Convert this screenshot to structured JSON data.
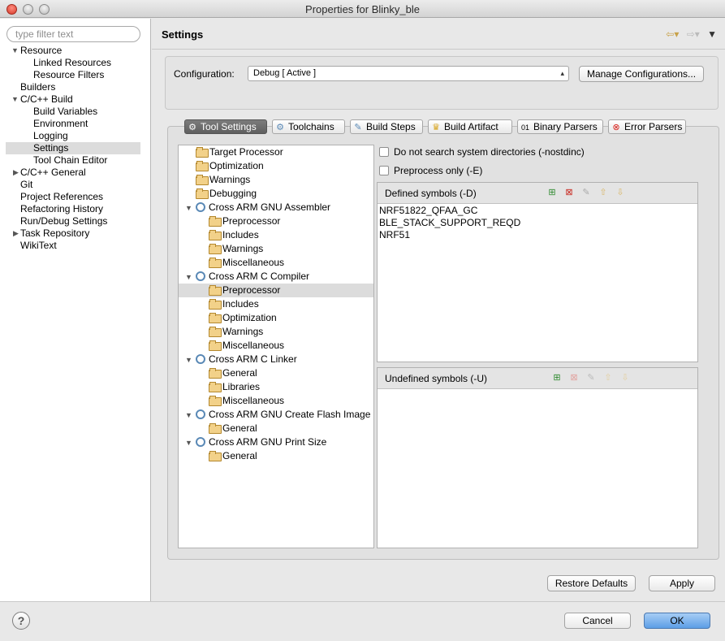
{
  "window": {
    "title": "Properties for Blinky_ble"
  },
  "filter": {
    "placeholder": "type filter text"
  },
  "nav": {
    "items": [
      {
        "label": "Resource",
        "expanded": true
      },
      {
        "label": "Linked Resources"
      },
      {
        "label": "Resource Filters"
      },
      {
        "label": "Builders"
      },
      {
        "label": "C/C++ Build",
        "expanded": true
      },
      {
        "label": "Build Variables"
      },
      {
        "label": "Environment"
      },
      {
        "label": "Logging"
      },
      {
        "label": "Settings",
        "selected": true
      },
      {
        "label": "Tool Chain Editor"
      },
      {
        "label": "C/C++ General",
        "expanded": false
      },
      {
        "label": "Git"
      },
      {
        "label": "Project References"
      },
      {
        "label": "Refactoring History"
      },
      {
        "label": "Run/Debug Settings"
      },
      {
        "label": "Task Repository",
        "expanded": false
      },
      {
        "label": "WikiText"
      }
    ]
  },
  "page": {
    "title": "Settings"
  },
  "config": {
    "label": "Configuration:",
    "selected": "Debug  [ Active ]",
    "manage_button": "Manage Configurations..."
  },
  "tabs": [
    {
      "label": "Tool Settings",
      "icon": "tool-settings-icon",
      "active": true
    },
    {
      "label": "Toolchains",
      "icon": "toolchains-icon"
    },
    {
      "label": "Build Steps",
      "icon": "build-steps-icon"
    },
    {
      "label": "Build Artifact",
      "icon": "trophy-icon"
    },
    {
      "label": "Binary Parsers",
      "icon": "binary-icon"
    },
    {
      "label": "Error Parsers",
      "icon": "error-icon"
    }
  ],
  "tool_tree": [
    {
      "label": "Target Processor",
      "kind": "folder"
    },
    {
      "label": "Optimization",
      "kind": "folder"
    },
    {
      "label": "Warnings",
      "kind": "folder"
    },
    {
      "label": "Debugging",
      "kind": "folder"
    },
    {
      "label": "Cross ARM GNU Assembler",
      "kind": "tool"
    },
    {
      "label": "Preprocessor",
      "kind": "folder"
    },
    {
      "label": "Includes",
      "kind": "folder"
    },
    {
      "label": "Warnings",
      "kind": "folder"
    },
    {
      "label": "Miscellaneous",
      "kind": "folder"
    },
    {
      "label": "Cross ARM C Compiler",
      "kind": "tool"
    },
    {
      "label": "Preprocessor",
      "kind": "folder",
      "selected": true
    },
    {
      "label": "Includes",
      "kind": "folder"
    },
    {
      "label": "Optimization",
      "kind": "folder"
    },
    {
      "label": "Warnings",
      "kind": "folder"
    },
    {
      "label": "Miscellaneous",
      "kind": "folder"
    },
    {
      "label": "Cross ARM C Linker",
      "kind": "tool"
    },
    {
      "label": "General",
      "kind": "folder"
    },
    {
      "label": "Libraries",
      "kind": "folder"
    },
    {
      "label": "Miscellaneous",
      "kind": "folder"
    },
    {
      "label": "Cross ARM GNU Create Flash Image",
      "kind": "tool"
    },
    {
      "label": "General",
      "kind": "folder"
    },
    {
      "label": "Cross ARM GNU Print Size",
      "kind": "tool"
    },
    {
      "label": "General",
      "kind": "folder"
    }
  ],
  "options": {
    "nostdinc": {
      "label": "Do not search system directories (-nostdinc)",
      "checked": false
    },
    "preprocess_only": {
      "label": "Preprocess only (-E)",
      "checked": false
    }
  },
  "defined": {
    "title": "Defined symbols (-D)",
    "items": [
      "NRF51822_QFAA_GC",
      "BLE_STACK_SUPPORT_REQD",
      "NRF51"
    ]
  },
  "undefined": {
    "title": "Undefined symbols (-U)",
    "items": []
  },
  "buttons": {
    "restore": "Restore Defaults",
    "apply": "Apply",
    "cancel": "Cancel",
    "ok": "OK",
    "help": "?"
  }
}
